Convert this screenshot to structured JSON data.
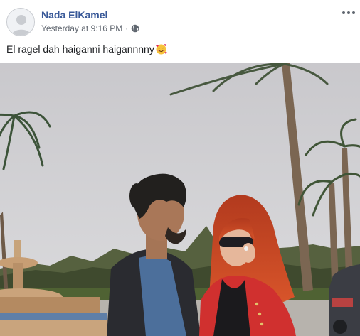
{
  "post": {
    "author": "Nada ElKamel",
    "timestamp": "Yesterday at 9:16 PM",
    "separator": "·",
    "privacy_icon": "globe-icon",
    "text": "El ragel dah haiganni haigannnny",
    "emoji": "smiling-face-with-hearts",
    "more_icon": "more-options-icon"
  },
  "colors": {
    "author_link": "#385898",
    "meta_text": "#616770",
    "body_text": "#1c1e21"
  }
}
